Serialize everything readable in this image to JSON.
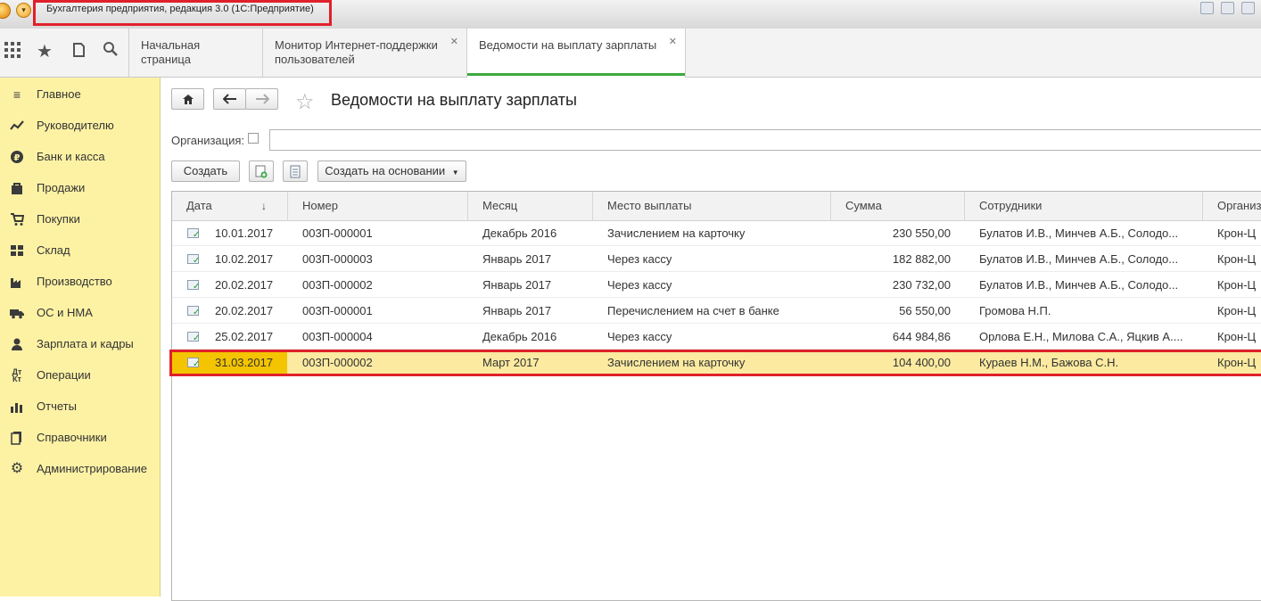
{
  "window": {
    "title": "Бухгалтерия предприятия, редакция 3.0  (1С:Предприятие)"
  },
  "tabs": [
    {
      "label": "Начальная страница"
    },
    {
      "label": "Монитор Интернет-поддержки пользователей"
    },
    {
      "label": "Ведомости на выплату зарплаты"
    }
  ],
  "sidebar": {
    "items": [
      {
        "label": "Главное",
        "icon": "menu-lines-icon"
      },
      {
        "label": "Руководителю",
        "icon": "trend-icon"
      },
      {
        "label": "Банк и касса",
        "icon": "ruble-icon"
      },
      {
        "label": "Продажи",
        "icon": "bag-icon"
      },
      {
        "label": "Покупки",
        "icon": "cart-icon"
      },
      {
        "label": "Склад",
        "icon": "warehouse-icon"
      },
      {
        "label": "Производство",
        "icon": "factory-icon"
      },
      {
        "label": "ОС и НМА",
        "icon": "truck-icon"
      },
      {
        "label": "Зарплата и кадры",
        "icon": "person-icon"
      },
      {
        "label": "Операции",
        "icon": "dt-kt-icon"
      },
      {
        "label": "Отчеты",
        "icon": "bar-chart-icon"
      },
      {
        "label": "Справочники",
        "icon": "books-icon"
      },
      {
        "label": "Администрирование",
        "icon": "gear-icon"
      }
    ]
  },
  "page": {
    "title": "Ведомости на выплату зарплаты",
    "org_label": "Организация:",
    "create_label": "Создать",
    "create_based_label": "Создать на основании"
  },
  "table": {
    "columns": [
      "Дата",
      "Номер",
      "Месяц",
      "Место выплаты",
      "Сумма",
      "Сотрудники",
      "Организ"
    ],
    "rows": [
      {
        "date": "10.01.2017",
        "number": "003П-000001",
        "month": "Декабрь 2016",
        "place": "Зачислением на карточку",
        "sum": "230 550,00",
        "employees": "Булатов И.В., Минчев А.Б., Солодо...",
        "org": "Крон-Ц"
      },
      {
        "date": "10.02.2017",
        "number": "003П-000003",
        "month": "Январь 2017",
        "place": "Через кассу",
        "sum": "182 882,00",
        "employees": "Булатов И.В., Минчев А.Б., Солодо...",
        "org": "Крон-Ц"
      },
      {
        "date": "20.02.2017",
        "number": "003П-000002",
        "month": "Январь 2017",
        "place": "Через кассу",
        "sum": "230 732,00",
        "employees": "Булатов И.В., Минчев А.Б., Солодо...",
        "org": "Крон-Ц"
      },
      {
        "date": "20.02.2017",
        "number": "003П-000001",
        "month": "Январь 2017",
        "place": "Перечислением на счет в банке",
        "sum": "56 550,00",
        "employees": "Громова Н.П.",
        "org": "Крон-Ц"
      },
      {
        "date": "25.02.2017",
        "number": "003П-000004",
        "month": "Декабрь 2016",
        "place": "Через кассу",
        "sum": "644 984,86",
        "employees": "Орлова Е.Н., Милова С.А., Яцкив А....",
        "org": "Крон-Ц"
      },
      {
        "date": "31.03.2017",
        "number": "003П-000002",
        "month": "Март 2017",
        "place": "Зачислением на карточку",
        "sum": "104 400,00",
        "employees": "Кураев Н.М., Бажова С.Н.",
        "org": "Крон-Ц"
      }
    ],
    "selected_row": 5
  },
  "colors": {
    "sidebar_bg": "#fdf2a4",
    "selected_row_bg": "#fbeaa0",
    "selected_cell_bg": "#f4c400",
    "active_tab_accent": "#3caa3c",
    "highlight_box": "#e0202a"
  }
}
